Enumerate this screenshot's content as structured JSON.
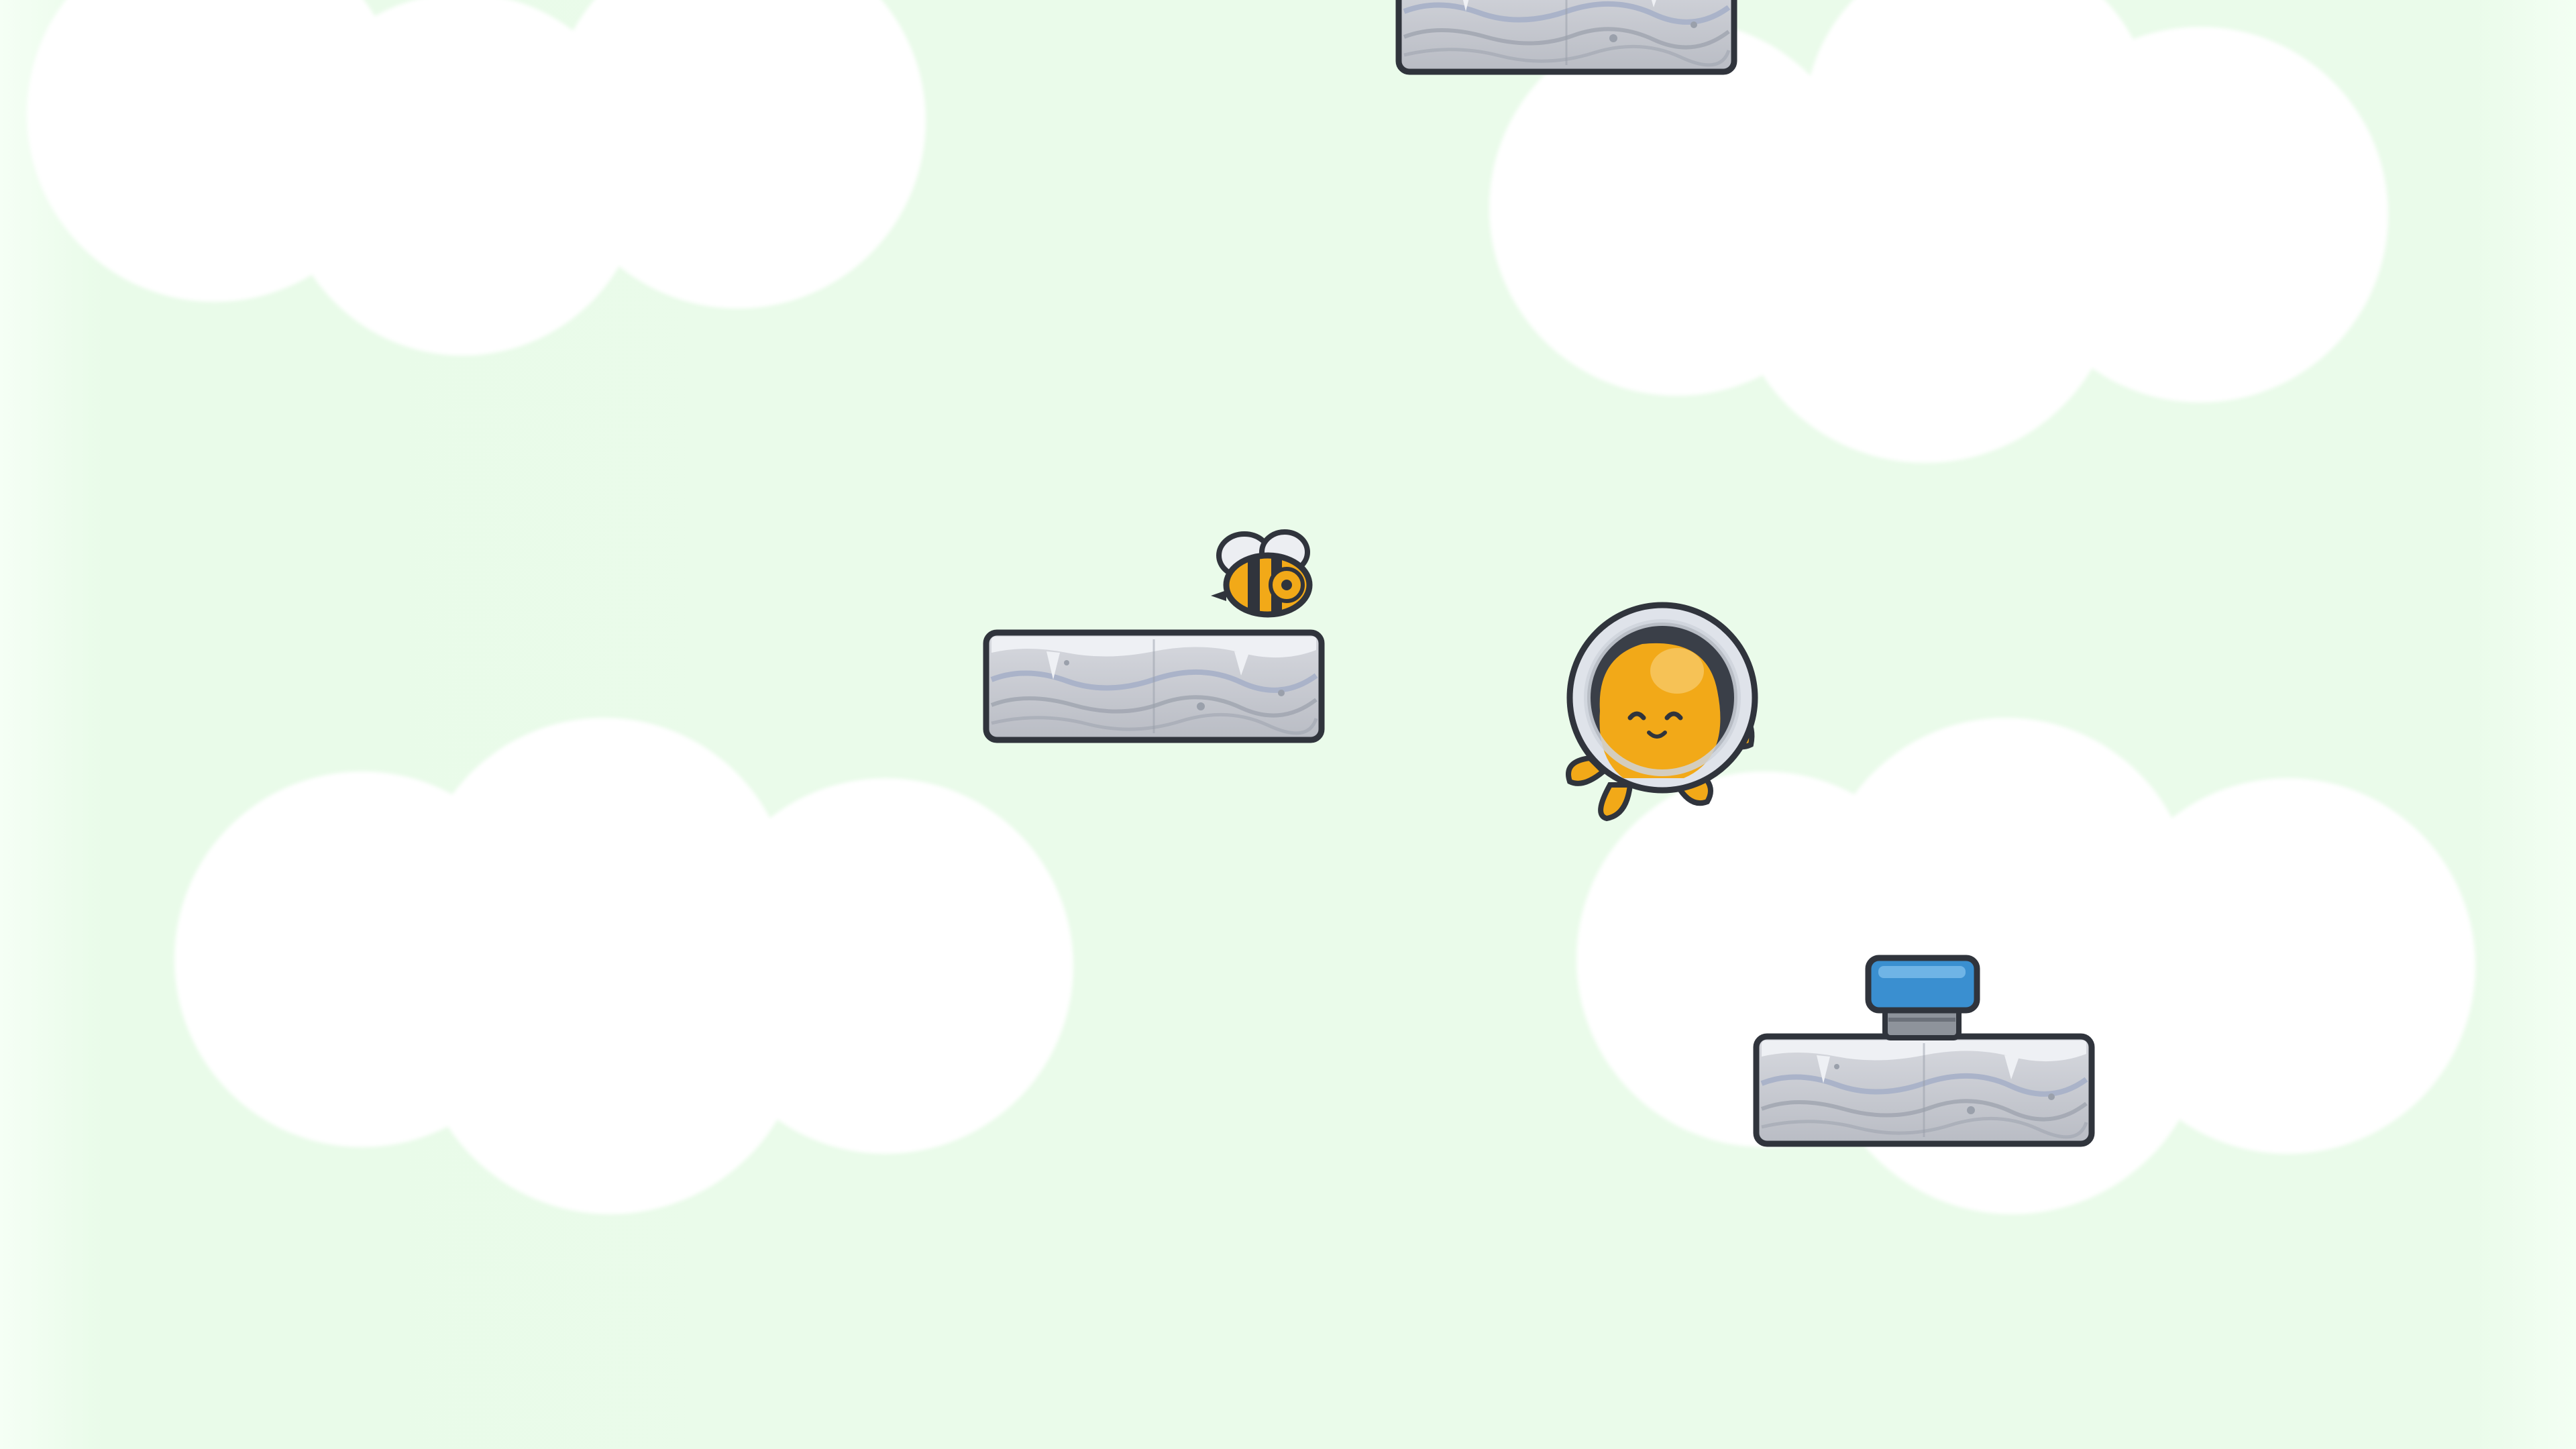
{
  "scene": {
    "sky_color": "#eafbea",
    "cloud_color": "#ffffff",
    "platform_color": "#c9ccd3",
    "outline_color": "#30343c",
    "spring_color": "#3a8fd0",
    "player_color": "#f2a918",
    "bee_body_color": "#f2a918",
    "helmet_color": "#dfe3ea"
  },
  "objects": {
    "clouds": [
      "cloud",
      "cloud",
      "cloud",
      "cloud"
    ],
    "platforms": [
      "stone-platform",
      "stone-platform",
      "stone-platform"
    ],
    "enemy": "bee",
    "player": "octopus-astronaut",
    "powerup": "spring"
  }
}
